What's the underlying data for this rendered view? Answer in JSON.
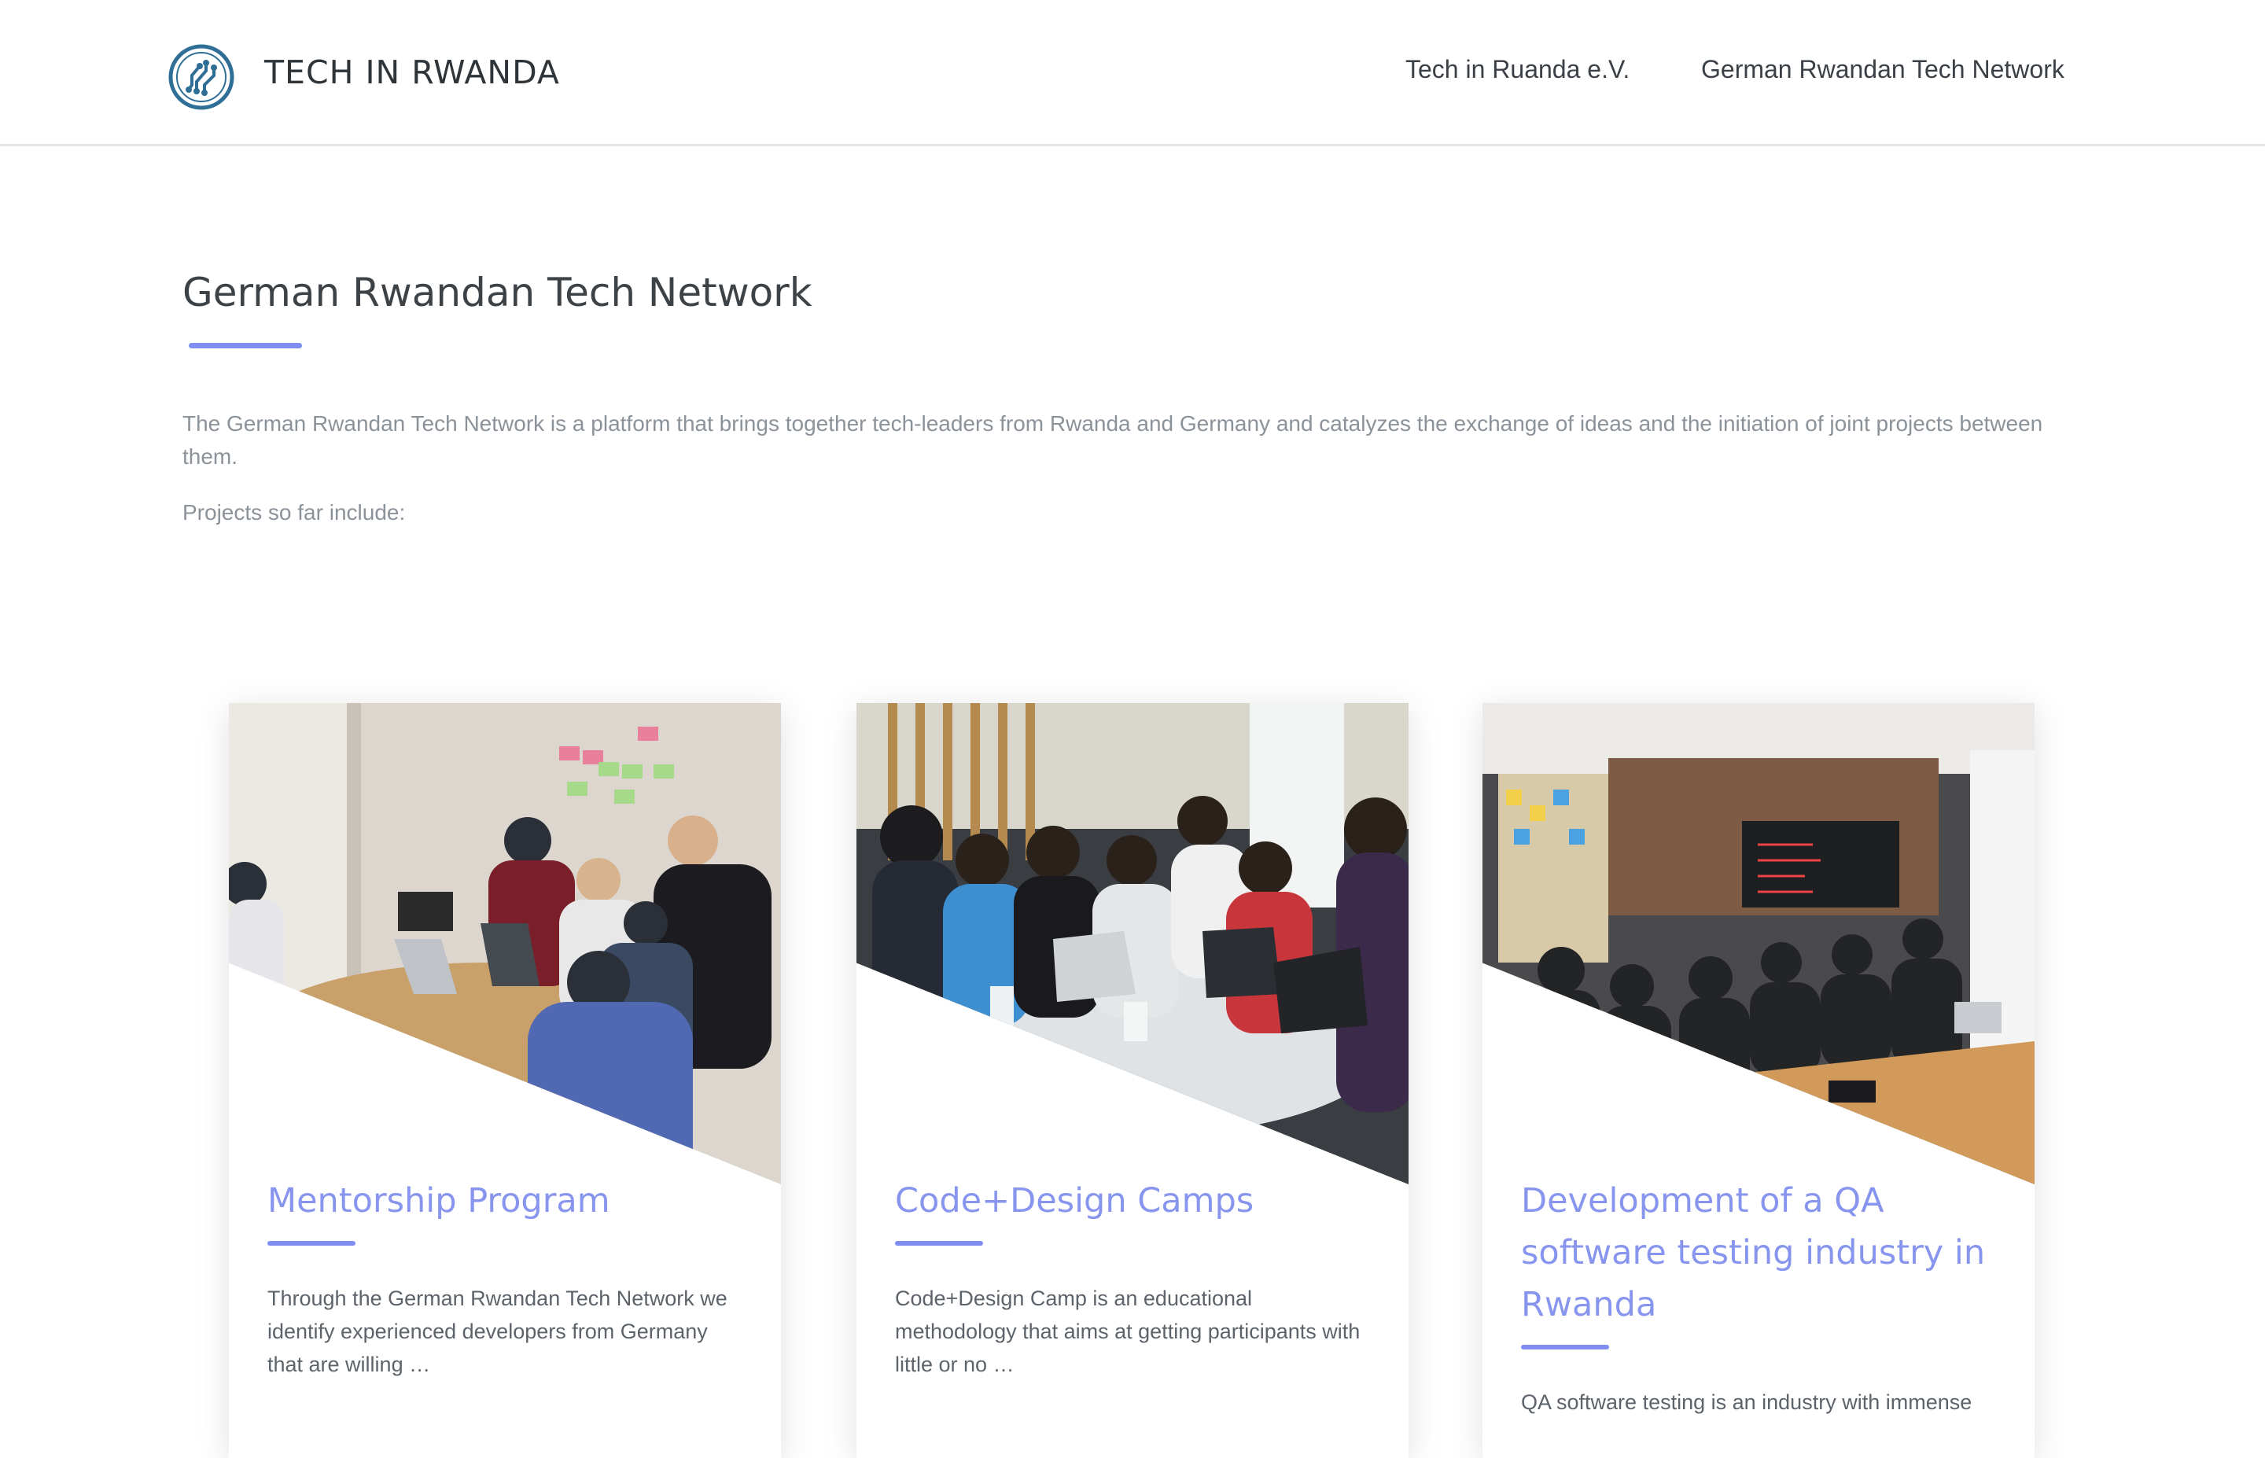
{
  "header": {
    "site_title": "TECH IN RWANDA",
    "logo_icon": "circuit-circle-icon",
    "nav": [
      {
        "label": "Tech in Ruanda e.V."
      },
      {
        "label": "German Rwandan Tech Network"
      }
    ]
  },
  "main": {
    "title": "German Rwandan Tech Network",
    "intro": "The German Rwandan Tech Network is a platform that brings together tech-leaders from Rwanda and Germany and catalyzes the exchange of ideas and the initiation of joint projects between them.",
    "projects_label": "Projects so far include:"
  },
  "cards": [
    {
      "title": "Mentorship Program",
      "text": "Through the German Rwandan Tech Network we identify experienced developers from Germany that are willing …"
    },
    {
      "title": "Code+Design Camps",
      "text": "Code+Design Camp is an educational methodology that aims at getting participants with little or no …"
    },
    {
      "title": "Development of a QA software testing industry in Rwanda",
      "text": "QA software testing is an industry with immense"
    }
  ],
  "colors": {
    "accent": "#7f8ef0",
    "card_title": "#8795ee",
    "body_text": "#8b9299",
    "heading": "#3d4247"
  }
}
